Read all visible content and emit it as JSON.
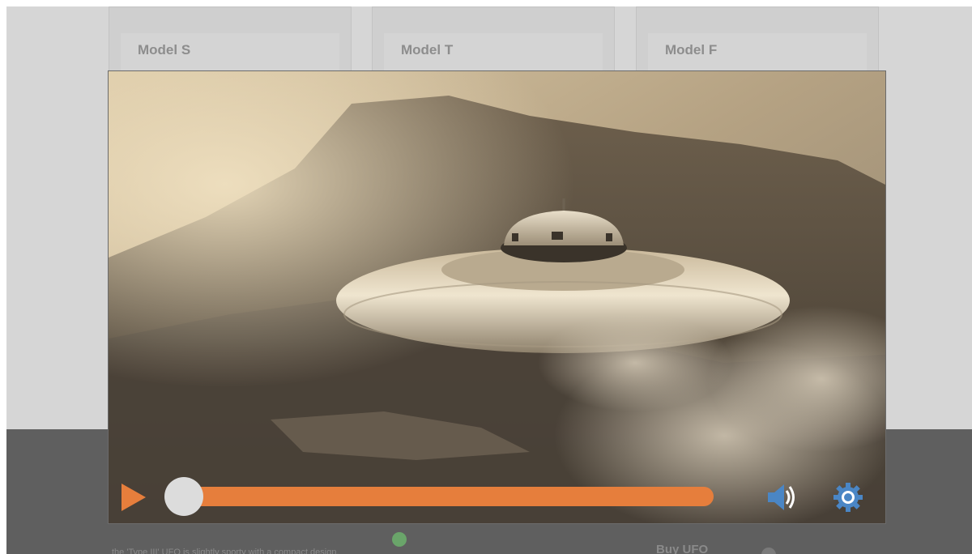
{
  "background": {
    "cards": [
      {
        "title": "Model S"
      },
      {
        "title": "Model T"
      },
      {
        "title": "Model F"
      }
    ],
    "footer_text": "the 'Type III' UFO is slightly sporty with a compact design.",
    "footer_right": "Buy UFO"
  },
  "player": {
    "accent_color": "#e67e3c",
    "progress_fraction": 0.0,
    "controls": {
      "play_icon": "play-icon",
      "volume_icon": "volume-icon",
      "settings_icon": "gear-icon"
    }
  }
}
